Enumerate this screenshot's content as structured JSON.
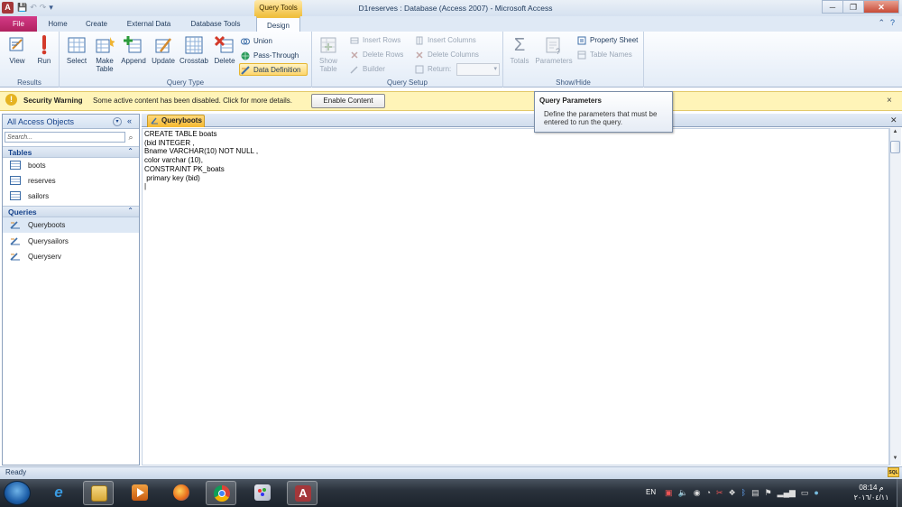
{
  "titlebar": {
    "app_icon": "A",
    "contextual_tab_group": "Query Tools",
    "window_title": "D1reserves : Database (Access 2007)  -  Microsoft Access",
    "minimize": "─",
    "maximize": "❐",
    "close": "✕",
    "qat": [
      "save-icon",
      "undo-icon",
      "redo-icon",
      "customize-icon"
    ]
  },
  "tabs": {
    "file": "File",
    "home": "Home",
    "create": "Create",
    "external_data": "External Data",
    "database_tools": "Database Tools",
    "design": "Design"
  },
  "ribbon": {
    "results": {
      "label": "Results",
      "view": "View",
      "run": "Run"
    },
    "query_type": {
      "label": "Query Type",
      "select": "Select",
      "make_table": "Make Table",
      "append": "Append",
      "update": "Update",
      "crosstab": "Crosstab",
      "delete": "Delete",
      "union": "Union",
      "pass_through": "Pass-Through",
      "data_definition": "Data Definition"
    },
    "query_setup": {
      "label": "Query Setup",
      "show_table": "Show Table",
      "insert_rows": "Insert Rows",
      "delete_rows": "Delete Rows",
      "builder": "Builder",
      "insert_columns": "Insert Columns",
      "delete_columns": "Delete Columns",
      "return": "Return:"
    },
    "show_hide": {
      "label": "Show/Hide",
      "totals": "Totals",
      "parameters": "Parameters",
      "property_sheet": "Property Sheet",
      "table_names": "Table Names"
    }
  },
  "security_warning": {
    "title": "Security Warning",
    "message": "Some active content has been disabled. Click for more details.",
    "button": "Enable Content",
    "close": "×"
  },
  "tooltip": {
    "title": "Query Parameters",
    "body": "Define the parameters that must be entered to run the query."
  },
  "nav_pane": {
    "title": "All Access Objects",
    "search_placeholder": "Search...",
    "tables_header": "Tables",
    "tables": [
      "boots",
      "reserves",
      "sailors"
    ],
    "queries_header": "Queries",
    "queries": [
      "Queryboots",
      "Querysailors",
      "Queryserv"
    ]
  },
  "document": {
    "tab_label": "Queryboots",
    "sql": "CREATE TABLE boats\n(bid INTEGER ,\nBname VARCHAR(10) NOT NULL ,\ncolor varchar (10),\nCONSTRAINT PK_boats\n primary key (bid)\n|"
  },
  "statusbar": {
    "text": "Ready",
    "sql_view": "SQL"
  },
  "taskbar": {
    "apps": [
      "start-orb",
      "internet-explorer",
      "file-explorer",
      "media-player",
      "firefox",
      "chrome",
      "paint",
      "access"
    ],
    "language": "EN",
    "time": "08:14 م",
    "date": "٢٠١٦/٠٤/١١"
  },
  "colors": {
    "file_tab": "#b0225f",
    "contextual_tab": "#f0c040",
    "warning_bar": "#fff4b8",
    "access_red": "#a4373a",
    "ribbon_text": "#1e395b"
  }
}
